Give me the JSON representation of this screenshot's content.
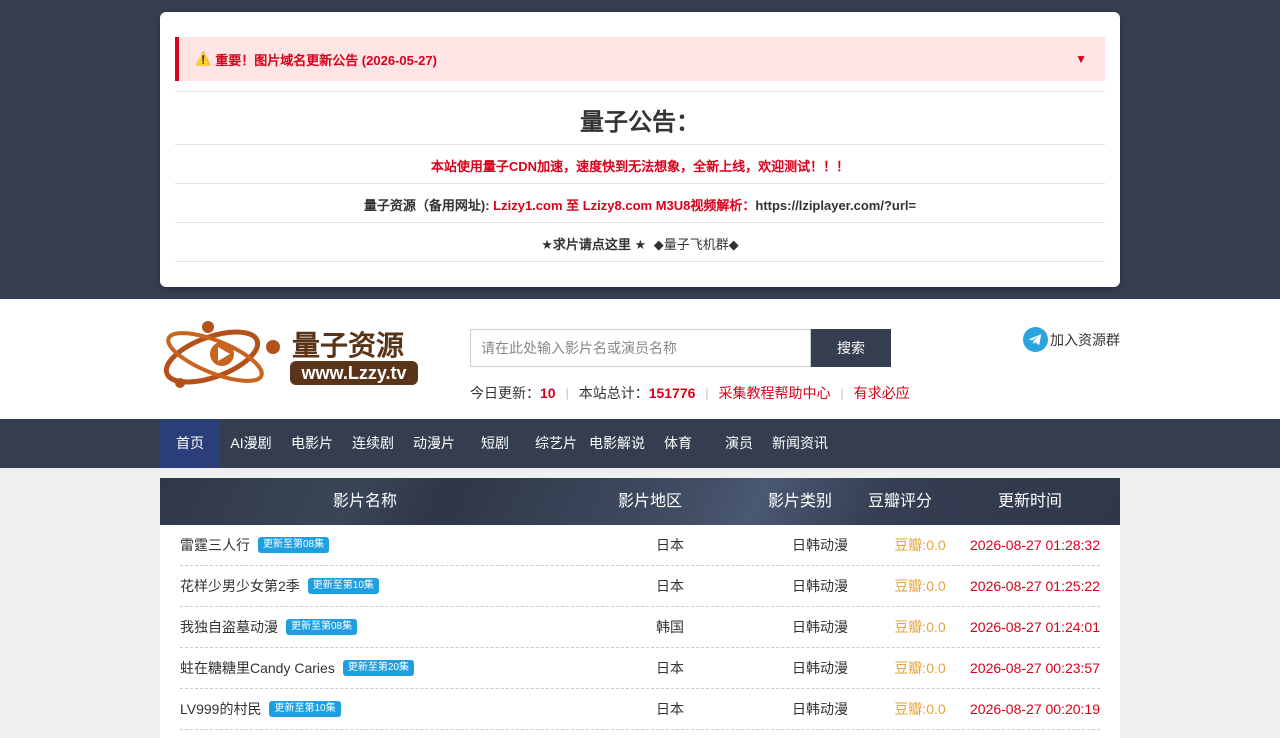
{
  "notice": {
    "alert_icon": "⚠️",
    "alert_text": "重要！图片域名更新公告 (2026-05-27)",
    "toggle_icon": "▼",
    "title": "量子公告：",
    "line1": "本站使用量子CDN加速，速度快到无法想象，全新上线，欢迎测试！！！",
    "line2_prefix": "量子资源（备用网址): ",
    "line2_domains": "Lzizy1.com 至 Lzizy8.com M3U8视频解析：",
    "line2_url": "https://lziplayer.com/?url=",
    "line3_request": "★求片请点这里 ★",
    "line3_group": "◆量子飞机群◆"
  },
  "header": {
    "logo_text": "量子资源",
    "logo_url": "www.Lzzy.tv",
    "search_placeholder": "请在此处输入影片名或演员名称",
    "search_button": "搜索",
    "join_group": "加入资源群",
    "stats": {
      "today_label": "今日更新：",
      "today_value": "10",
      "total_label": "本站总计：",
      "total_value": "151776",
      "help_link": "采集教程帮助中心",
      "request_link": "有求必应"
    }
  },
  "nav": [
    "首页",
    "AI漫剧",
    "电影片",
    "连续剧",
    "动漫片",
    "短剧",
    "综艺片",
    "电影解说",
    "体育",
    "演员",
    "新闻资讯"
  ],
  "table": {
    "headers": [
      "影片名称",
      "影片地区",
      "影片类别",
      "豆瓣评分",
      "更新时间"
    ],
    "rows": [
      {
        "name": "雷霆三人行",
        "badge": "更新至第08集",
        "area": "日本",
        "category": "日韩动漫",
        "score": "豆瓣:0.0",
        "time": "2026-08-27 01:28:32"
      },
      {
        "name": "花样少男少女第2季",
        "badge": "更新至第10集",
        "area": "日本",
        "category": "日韩动漫",
        "score": "豆瓣:0.0",
        "time": "2026-08-27 01:25:22"
      },
      {
        "name": "我独自盗墓动漫",
        "badge": "更新至第08集",
        "area": "韩国",
        "category": "日韩动漫",
        "score": "豆瓣:0.0",
        "time": "2026-08-27 01:24:01"
      },
      {
        "name": "蛀在糖糖里Candy Caries",
        "badge": "更新至第20集",
        "area": "日本",
        "category": "日韩动漫",
        "score": "豆瓣:0.0",
        "time": "2026-08-27 00:23:57"
      },
      {
        "name": "LV999的村民",
        "badge": "更新至第10集",
        "area": "日本",
        "category": "日韩动漫",
        "score": "豆瓣:0.0",
        "time": "2026-08-27 00:20:19"
      }
    ]
  },
  "colors": {
    "dark_band": "#353e4f",
    "accent_red": "#d9001b",
    "badge_blue": "#1e9fe0",
    "score_orange": "#e6a23c",
    "nav_active": "#2c3e7a"
  }
}
